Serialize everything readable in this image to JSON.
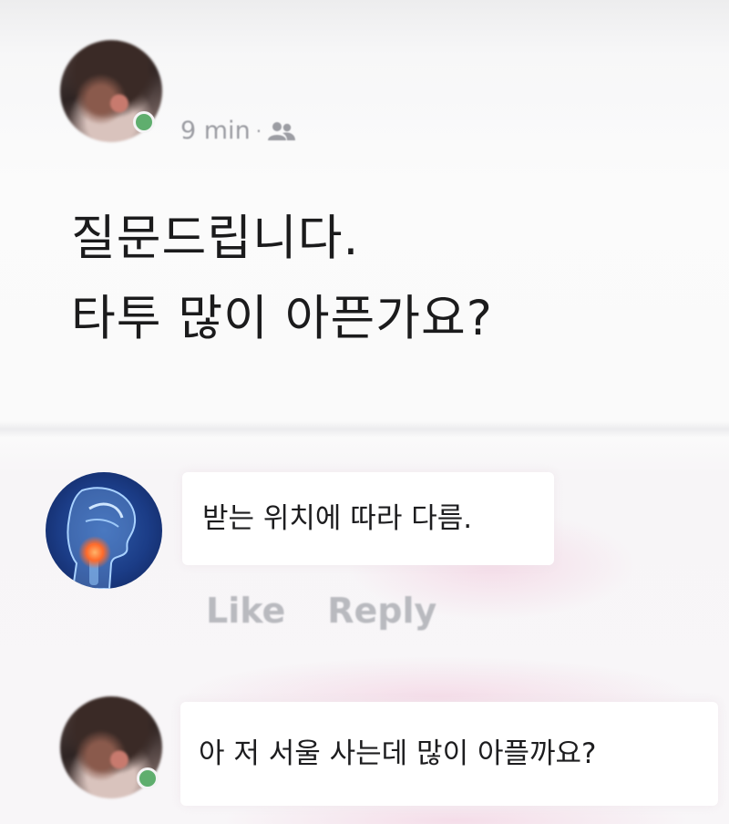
{
  "post": {
    "time": "9 min",
    "separator": "·",
    "audience_icon": "friends-icon",
    "text_line_1": "질문드립니다.",
    "text_line_2": "타투 많이 아픈가요?"
  },
  "comments": [
    {
      "avatar": "xray-throat-avatar",
      "text": "받는 위치에 따라 다름.",
      "actions": {
        "like": "Like",
        "reply": "Reply"
      }
    },
    {
      "avatar": "person-avatar",
      "online": true,
      "text": "아 저 서울 사는데 많이 아플까요?"
    }
  ],
  "colors": {
    "online": "#5fae6e",
    "meta_text": "#9c9da3",
    "action_text": "#b9babf",
    "xray_blue": "#1b3c86"
  }
}
